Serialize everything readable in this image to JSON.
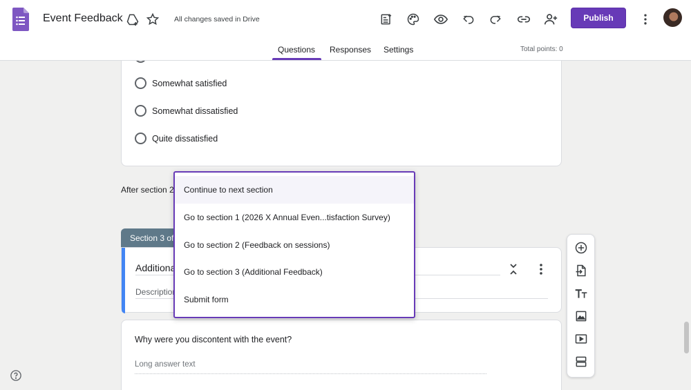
{
  "header": {
    "title": "Event Feedback",
    "saved_status": "All changes saved in Drive",
    "publish_label": "Publish",
    "icons": [
      "forms-logo-icon",
      "add-to-drive-icon",
      "star-icon",
      "addon-icon",
      "palette-icon",
      "preview-eye-icon",
      "undo-icon",
      "redo-icon",
      "link-icon",
      "add-collaborator-icon",
      "more-vert-icon"
    ]
  },
  "tabs": [
    {
      "label": "Questions",
      "active": true
    },
    {
      "label": "Responses",
      "active": false
    },
    {
      "label": "Settings",
      "active": false
    }
  ],
  "total_points": "Total points: 0",
  "question_options": [
    "Somewhat satisfied",
    "Somewhat dissatisfied",
    "Quite dissatisfied"
  ],
  "after_section_label": "After section 2",
  "section": {
    "tag": "Section 3 of",
    "title": "Additiona",
    "description_placeholder": "Description"
  },
  "dropdown": {
    "items": [
      "Continue to next section",
      "Go to section 1 (2026 X Annual Even...tisfaction Survey)",
      "Go to section 2 (Feedback on sessions)",
      "Go to section 3 (Additional Feedback)",
      "Submit form"
    ],
    "selected_index": 0
  },
  "question": {
    "title": "Why were you discontent with the event?",
    "placeholder": "Long answer text"
  },
  "side_toolbar": [
    "add-question-icon",
    "import-questions-icon",
    "add-title-icon",
    "add-image-icon",
    "add-video-icon",
    "add-section-icon"
  ],
  "colors": {
    "accent": "#673ab7",
    "section_tag": "#5f7989",
    "section_accent": "#4285f4",
    "background": "#f0f0ef"
  }
}
